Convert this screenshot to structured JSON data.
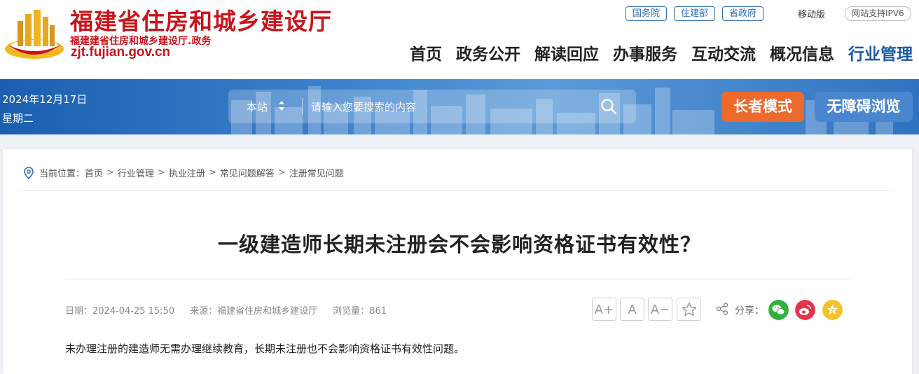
{
  "header": {
    "site_title": "福建省住房和城乡建设厅",
    "site_subtitle": "福建建省住房和城乡建设厅.政务",
    "site_domain": "zjt.fujian.gov.cn",
    "top_links": [
      "国务院",
      "住建部",
      "省政府"
    ],
    "mobile_label": "移动版",
    "ipv6_label": "网站支持IPV6",
    "nav": [
      "首页",
      "政务公开",
      "解读回应",
      "办事服务",
      "互动交流",
      "概况信息",
      "行业管理"
    ],
    "active_nav": "行业管理"
  },
  "banner": {
    "date": "2024年12月17日",
    "weekday": "星期二",
    "search_scope": "本站",
    "search_placeholder": "请输入您要搜索的内容",
    "elder_mode_label": "长者模式",
    "accessibility_label": "无障碍浏览"
  },
  "breadcrumb": {
    "prefix": "当前位置：",
    "items": [
      "首页",
      "行业管理",
      "执业注册",
      "常见问题解答",
      "注册常见问题"
    ],
    "separator": ">"
  },
  "article": {
    "title": "一级建造师长期未注册会不会影响资格证书有效性？",
    "date": "日期：2024-04-25 15:50",
    "source": "来源：福建省住房和城乡建设厅",
    "views": "浏览量：861",
    "font_larger": "A+",
    "font_normal": "A",
    "font_smaller": "A−",
    "share_label": "分享：",
    "body": "未办理注册的建造师无需办理继续教育，长期未注册也不会影响资格证书有效性问题。"
  },
  "icons": {
    "location": "location-pin-icon",
    "search": "search-icon",
    "favorite": "star-icon",
    "share": "share-icon",
    "wechat": "wechat-icon",
    "weibo": "weibo-icon",
    "qzone": "qzone-star-icon"
  },
  "colors": {
    "brand_red": "#c8141c",
    "brand_blue": "#1a5aa6",
    "elder_orange": "#ec6a2c",
    "wechat_green": "#2fb13b",
    "weibo_red": "#e6344a",
    "qzone_yellow": "#f2c42c"
  }
}
